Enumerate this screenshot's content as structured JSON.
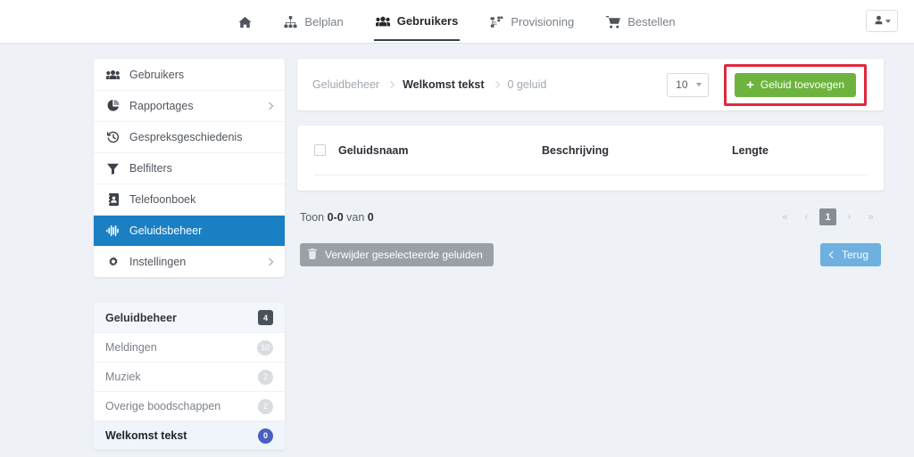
{
  "topnav": {
    "items": [
      {
        "label": "",
        "icon": "home-icon",
        "active": false
      },
      {
        "label": "Belplan",
        "icon": "sitemap-icon",
        "active": false
      },
      {
        "label": "Gebruikers",
        "icon": "users-icon",
        "active": true
      },
      {
        "label": "Provisioning",
        "icon": "network-icon",
        "active": false
      },
      {
        "label": "Bestellen",
        "icon": "cart-icon",
        "active": false
      }
    ],
    "user_menu": {
      "icon": "user-icon",
      "caret": "chevron-down-icon"
    }
  },
  "sidebar": {
    "items": [
      {
        "label": "Gebruikers",
        "icon": "users-icon",
        "selected": false,
        "chevron": false
      },
      {
        "label": "Rapportages",
        "icon": "pie-chart-icon",
        "selected": false,
        "chevron": true
      },
      {
        "label": "Gespreksgeschiedenis",
        "icon": "history-icon",
        "selected": false,
        "chevron": false
      },
      {
        "label": "Belfilters",
        "icon": "filter-icon",
        "selected": false,
        "chevron": false
      },
      {
        "label": "Telefoonboek",
        "icon": "address-book-icon",
        "selected": false,
        "chevron": false
      },
      {
        "label": "Geluidsbeheer",
        "icon": "audio-wave-icon",
        "selected": true,
        "chevron": false
      },
      {
        "label": "Instellingen",
        "icon": "gear-icon",
        "selected": false,
        "chevron": true
      }
    ]
  },
  "sound_panel": {
    "rows": [
      {
        "label": "Geluidbeheer",
        "count": "4",
        "style": "header"
      },
      {
        "label": "Meldingen",
        "count": "10",
        "style": "normal"
      },
      {
        "label": "Muziek",
        "count": "2",
        "style": "normal"
      },
      {
        "label": "Overige boodschappen",
        "count": "2",
        "style": "normal"
      },
      {
        "label": "Welkomst tekst",
        "count": "0",
        "style": "active"
      }
    ]
  },
  "toolbar": {
    "breadcrumb": {
      "root": "Geluidbeheer",
      "current": "Welkomst tekst",
      "tail": "0 geluid"
    },
    "page_size": "10",
    "add_button": "Geluid toevoegen",
    "highlight_color": "#e0283c",
    "green_color": "#6eb33e"
  },
  "table": {
    "columns": [
      "Geluidsnaam",
      "Beschrijving",
      "Lengte"
    ],
    "rows": []
  },
  "footer": {
    "showing_prefix": "Toon",
    "showing_range": "0-0",
    "showing_mid": "van",
    "showing_total": "0",
    "pagination": {
      "first": "«",
      "prev": "‹",
      "current": "1",
      "next": "›",
      "last": "»"
    }
  },
  "actions": {
    "delete_label": "Verwijder geselecteerde geluiden",
    "back_label": "Terug"
  }
}
